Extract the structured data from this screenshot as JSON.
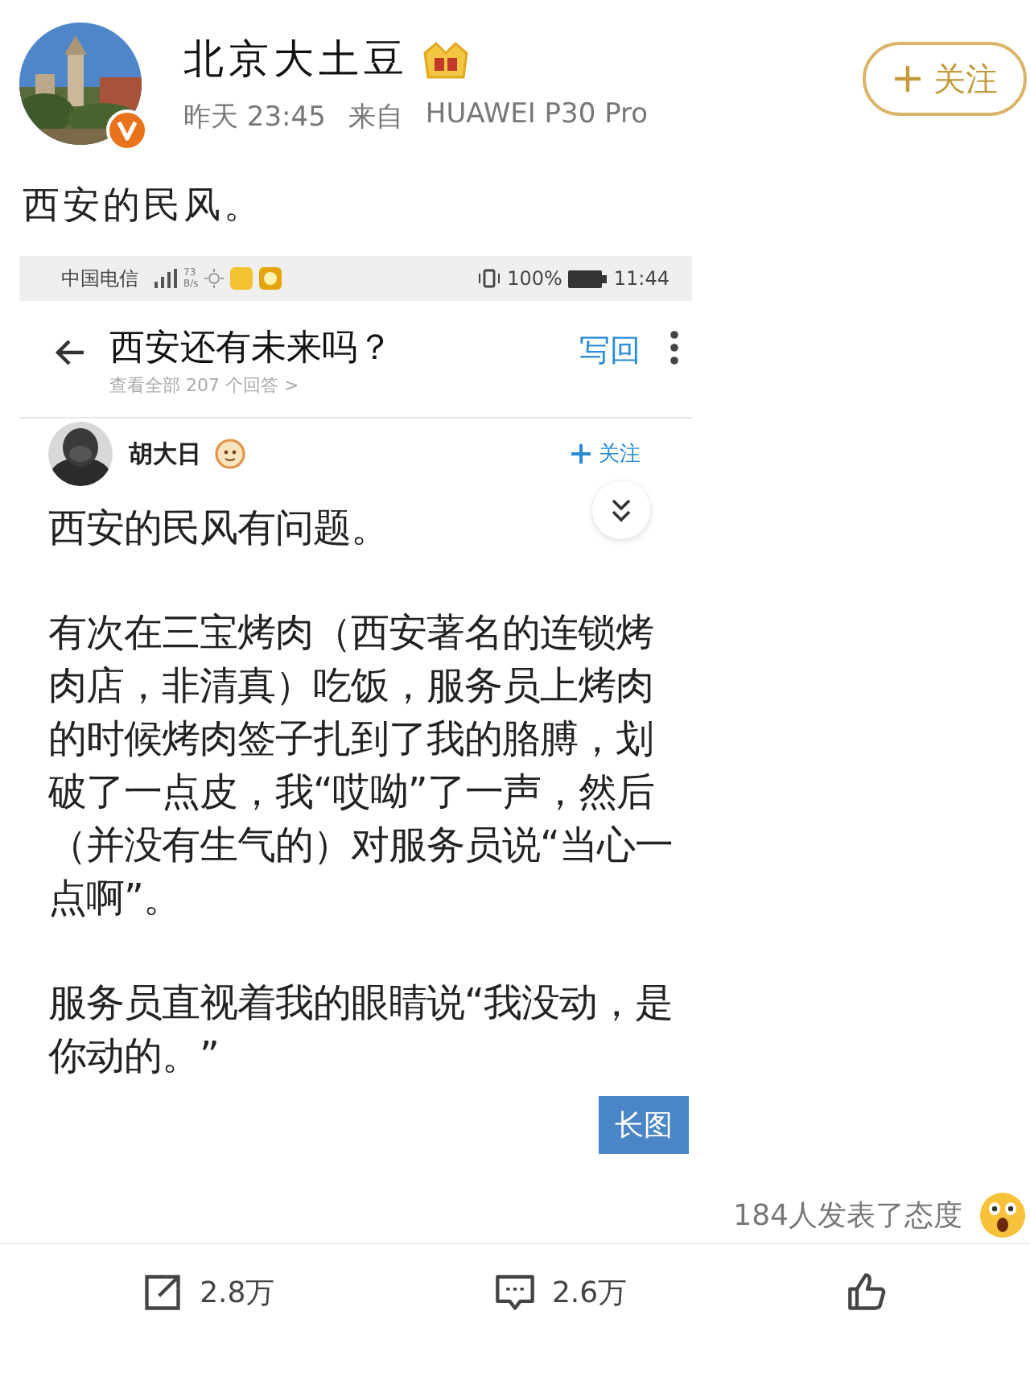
{
  "post": {
    "author": "北京大土豆",
    "time": "昨天 23:45",
    "source_prefix": "来自",
    "source": "HUAWEI P30 Pro",
    "follow_label": "关注",
    "text": "西安的民风。"
  },
  "embedded": {
    "status_bar": {
      "carrier": "中国电信",
      "speed": "73",
      "speed_unit": "B/s",
      "battery": "100%",
      "time": "11:44"
    },
    "title": "西安还有未来吗？",
    "reply_button": "写回",
    "subtitle": "查看全部 207 个回答 >",
    "answer": {
      "author": "胡大日",
      "follow_label": "关注",
      "paragraphs": [
        "西安的民风有问题。",
        "有次在三宝烤肉（西安著名的连锁烤肉店，非清真）吃饭，服务员上烤肉的时候烤肉签子扎到了我的胳膊，划破了一点皮，我“哎呦”了一声，然后（并没有生气的）对服务员说“当心一点啊”。",
        "服务员直视着我的眼睛说“我没动，是你动的。”"
      ],
      "badge": "长图"
    }
  },
  "reactions": "184人发表了态度",
  "actions": [
    {
      "kind": "share",
      "count": "2.8万"
    },
    {
      "kind": "comment",
      "count": "2.6万"
    },
    {
      "kind": "like"
    }
  ]
}
